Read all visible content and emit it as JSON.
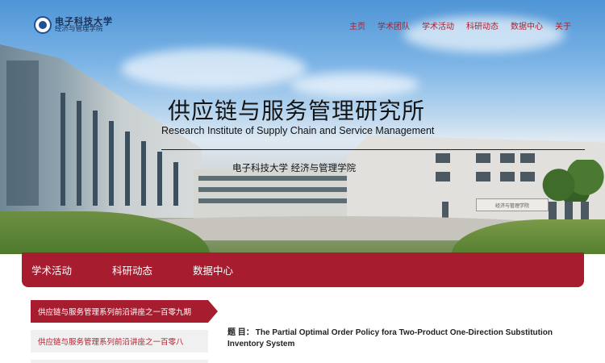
{
  "header": {
    "logo": {
      "university_name": "电子科技大学",
      "school_name": "经济与管理学院"
    },
    "nav": [
      "主页",
      "学术团队",
      "学术活动",
      "科研动态",
      "数据中心",
      "关于"
    ]
  },
  "hero": {
    "title_zh": "供应链与服务管理研究所",
    "title_en": "Research Institute of Supply Chain and Service Management",
    "subtitle": "电子科技大学  经济与管理学院",
    "building_sign": "经济与管理学院"
  },
  "subnav": [
    "学术活动",
    "科研动态",
    "数据中心"
  ],
  "sidebar": {
    "items": [
      {
        "label": "供应链与服务管理系列前沿讲座之一百零九期",
        "active": true
      },
      {
        "label": "供应链与服务管理系列前沿讲座之一百零八",
        "active": false
      }
    ]
  },
  "article": {
    "label": "题 目：",
    "title": "The Partial Optimal Order Policy fora Two-Product One-Direction Substitution Inventory System"
  },
  "colors": {
    "accent": "#a71d2f",
    "nav_text": "#b01d2d"
  }
}
